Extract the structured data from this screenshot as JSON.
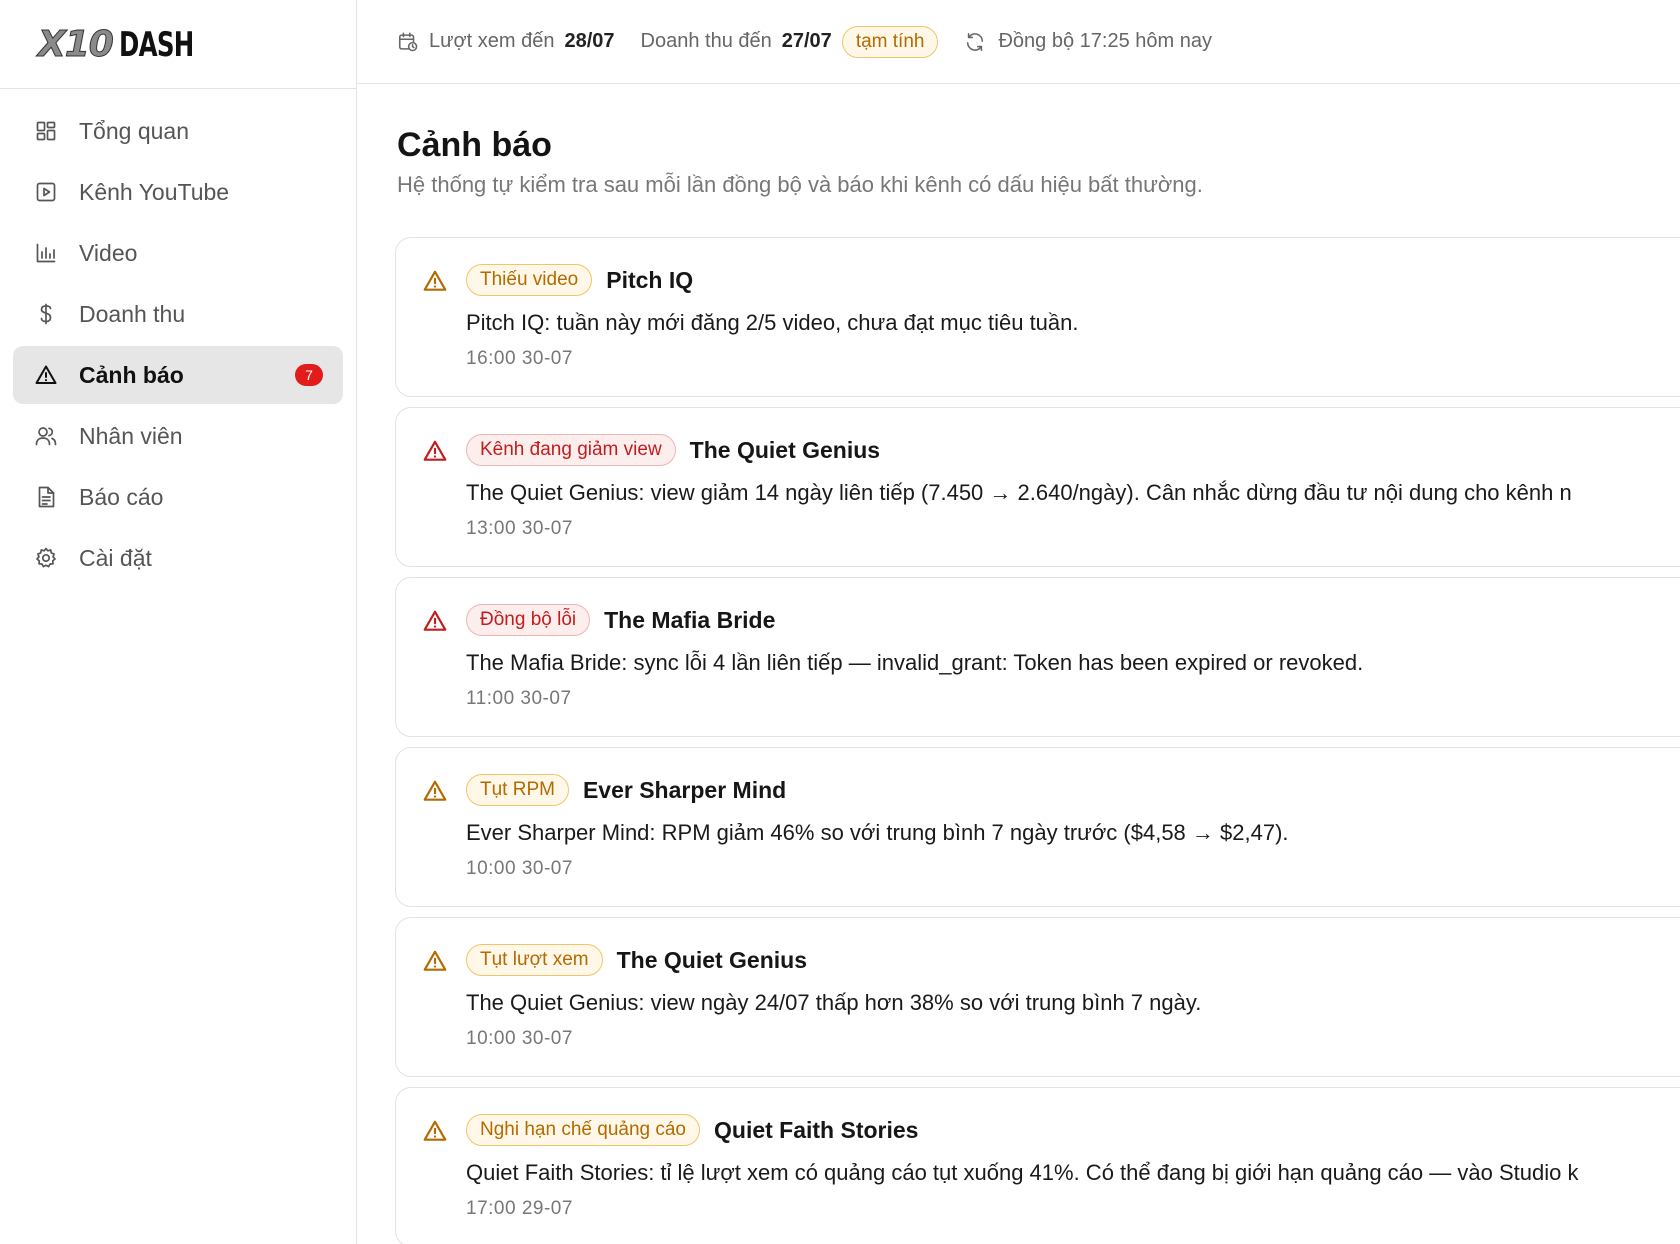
{
  "brand": {
    "logo_mark": "X10",
    "logo_text": "DASH"
  },
  "sidebar": {
    "items": [
      {
        "label": "Tổng quan",
        "icon": "dashboard-grid-icon"
      },
      {
        "label": "Kênh YouTube",
        "icon": "play-square-icon"
      },
      {
        "label": "Video",
        "icon": "bar-chart-icon"
      },
      {
        "label": "Doanh thu",
        "icon": "dollar-icon"
      },
      {
        "label": "Cảnh báo",
        "icon": "warning-triangle-icon",
        "badge": "7",
        "active": true
      },
      {
        "label": "Nhân viên",
        "icon": "users-icon"
      },
      {
        "label": "Báo cáo",
        "icon": "document-icon"
      },
      {
        "label": "Cài đặt",
        "icon": "gear-icon"
      }
    ]
  },
  "topbar": {
    "views_label": "Lượt xem đến",
    "views_date": "28/07",
    "revenue_label": "Doanh thu đến",
    "revenue_date": "27/07",
    "estimate_pill": "tạm tính",
    "sync_text": "Đồng bộ 17:25 hôm nay"
  },
  "page": {
    "title": "Cảnh báo",
    "subtitle": "Hệ thống tự kiểm tra sau mỗi lần đồng bộ và báo khi kênh có dấu hiệu bất thường."
  },
  "colors": {
    "amber": "#b36a00",
    "red": "#c21d1d",
    "badge": "#e21b1b"
  },
  "alerts": [
    {
      "tag": "Thiếu video",
      "severity": "amber",
      "channel": "Pitch IQ",
      "message": "Pitch IQ: tuần này mới đăng 2/5 video, chưa đạt mục tiêu tuần.",
      "time": "16:00 30-07"
    },
    {
      "tag": "Kênh đang giảm view",
      "severity": "red",
      "channel": "The Quiet Genius",
      "message": "The Quiet Genius: view giảm 14 ngày liên tiếp (7.450 → 2.640/ngày). Cân nhắc dừng đầu tư nội dung cho kênh n",
      "time": "13:00 30-07"
    },
    {
      "tag": "Đồng bộ lỗi",
      "severity": "red",
      "channel": "The Mafia Bride",
      "message": "The Mafia Bride: sync lỗi 4 lần liên tiếp — invalid_grant: Token has been expired or revoked.",
      "time": "11:00 30-07"
    },
    {
      "tag": "Tụt RPM",
      "severity": "amber",
      "channel": "Ever Sharper Mind",
      "message": "Ever Sharper Mind: RPM giảm 46% so với trung bình 7 ngày trước ($4,58 → $2,47).",
      "time": "10:00 30-07"
    },
    {
      "tag": "Tụt lượt xem",
      "severity": "amber",
      "channel": "The Quiet Genius",
      "message": "The Quiet Genius: view ngày 24/07 thấp hơn 38% so với trung bình 7 ngày.",
      "time": "10:00 30-07"
    },
    {
      "tag": "Nghi hạn chế quảng cáo",
      "severity": "amber",
      "channel": "Quiet Faith Stories",
      "message": "Quiet Faith Stories: tỉ lệ lượt xem có quảng cáo tụt xuống 41%. Có thể đang bị giới hạn quảng cáo — vào Studio k",
      "time": "17:00 29-07"
    }
  ]
}
